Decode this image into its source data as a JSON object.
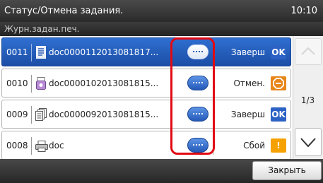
{
  "header": {
    "title": "Статус/Отмена задания.",
    "time": "10:10"
  },
  "subheader": {
    "label": "Журн.задан.печ."
  },
  "jobs": [
    {
      "num": "0011",
      "icon": "document-icon",
      "name": "doc0000112013081817...",
      "status": "Заверш",
      "status_icon": "ok-icon",
      "status_icon_text": "OK",
      "selected": true
    },
    {
      "num": "0010",
      "icon": "usb-memory-icon",
      "name": "doc0000102013081815...",
      "status": "Отмен.",
      "status_icon": "cancel-icon",
      "status_icon_text": "",
      "selected": false
    },
    {
      "num": "0009",
      "icon": "multi-document-icon",
      "name": "doc0000092013081815...",
      "status": "Заверш",
      "status_icon": "ok-icon",
      "status_icon_text": "OK",
      "selected": false
    },
    {
      "num": "0008",
      "icon": "printer-icon",
      "name": "doc",
      "status": "Сбой",
      "status_icon": "error-icon",
      "status_icon_text": "!",
      "selected": false
    }
  ],
  "pager": {
    "page": "1/3"
  },
  "footer": {
    "close_label": "Закрыть"
  },
  "colors": {
    "selected_row": "#2a63c4",
    "highlight": "#e10a14",
    "ok": "#2c62c4",
    "cancel": "#e8861a",
    "error": "#f5a100"
  }
}
